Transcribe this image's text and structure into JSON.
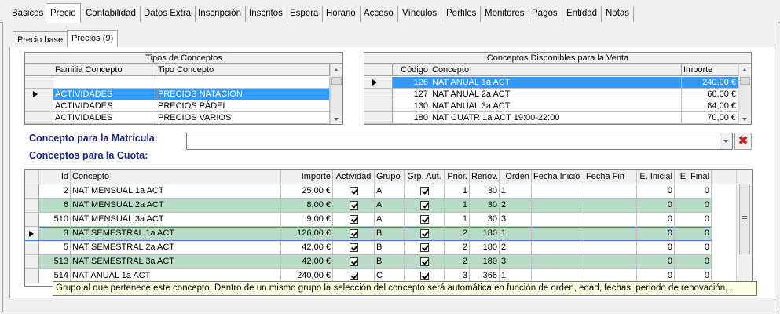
{
  "top_tabs": [
    "Básicos",
    "Precio",
    "Contabilidad",
    "Datos Extra",
    "Inscripción",
    "Inscritos",
    "Espera",
    "Horario",
    "Acceso",
    "Vínculos",
    "Perfiles",
    "Monitores",
    "Pagos",
    "Entidad",
    "Notas"
  ],
  "sub_tabs": [
    "Precio base",
    "Precios (9)"
  ],
  "tipos": {
    "title": "Tipos de Conceptos",
    "headers": [
      "Familia Concepto",
      "Tipo Concepto"
    ],
    "rows": [
      [
        "",
        ""
      ],
      [
        "ACTIVIDADES",
        "PRECIOS NATACIÓN"
      ],
      [
        "ACTIVIDADES",
        "PRECIOS PÁDEL"
      ],
      [
        "ACTIVIDADES",
        "PRECIOS VARIOS"
      ]
    ]
  },
  "disponibles": {
    "title": "Conceptos Disponibles para la Venta",
    "headers": [
      "Código",
      "Concepto",
      "Importe"
    ],
    "rows": [
      [
        "126",
        "NAT ANUAL 1a ACT",
        "240,00 €"
      ],
      [
        "127",
        "NAT ANUAL 2a ACT",
        "60,00 €"
      ],
      [
        "130",
        "NAT ANUAL 3a ACT",
        "84,00 €"
      ],
      [
        "180",
        "NAT CUATR 1a ACT 19:00-22:00",
        "70,00 €"
      ]
    ]
  },
  "labels": {
    "matricula": "Concepto para la Matrícula:",
    "cuota": "Conceptos para la Cuota:",
    "clear": "✖"
  },
  "cuota": {
    "headers": [
      "Id",
      "Concepto",
      "Importe",
      "Actividad",
      "Grupo",
      "Grp. Aut.",
      "Prior.",
      "Renov.",
      "Orden",
      "Fecha Inicio",
      "Fecha Fin",
      "E. Inicial",
      "E. Final"
    ],
    "rows": [
      [
        "2",
        "NAT MENSUAL 1a ACT",
        "25,00 €",
        "A",
        "1",
        "30",
        "1",
        "0",
        "0"
      ],
      [
        "6",
        "NAT MENSUAL 2a ACT",
        "8,00 €",
        "A",
        "1",
        "30",
        "2",
        "0",
        "0"
      ],
      [
        "510",
        "NAT MENSUAL 3a ACT",
        "9,00 €",
        "A",
        "1",
        "30",
        "3",
        "0",
        "0"
      ],
      [
        "3",
        "NAT SEMESTRAL 1a ACT",
        "126,00 €",
        "B",
        "2",
        "180",
        "1",
        "0",
        "0"
      ],
      [
        "5",
        "NAT SEMESTRAL 2a ACT",
        "42,00 €",
        "B",
        "2",
        "180",
        "2",
        "0",
        "0"
      ],
      [
        "513",
        "NAT SEMESTRAL 3a ACT",
        "42,00 €",
        "B",
        "2",
        "180",
        "3",
        "0",
        "0"
      ],
      [
        "514",
        "NAT ANUAL 1a ACT",
        "240,00 €",
        "C",
        "3",
        "365",
        "1",
        "0",
        "0"
      ]
    ]
  },
  "tooltip": "Grupo al que pertenece este concepto. Dentro de un mismo grupo la selección del concepto será automática en función de orden, edad, fechas, periodo de renovación,...",
  "colors": {
    "selection": "#3399ff",
    "green_row": "#b9dcc8",
    "label": "#1a237e"
  }
}
